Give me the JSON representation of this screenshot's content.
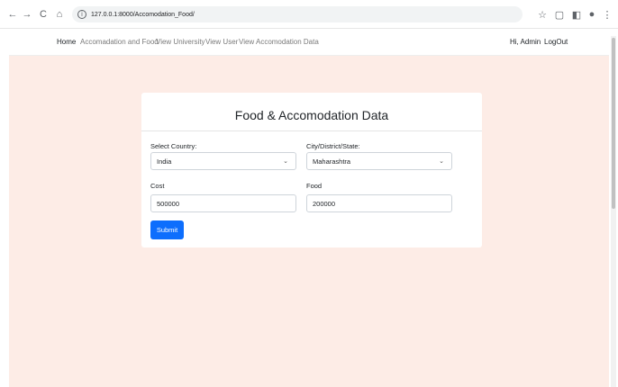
{
  "browser": {
    "url": "127.0.0.1:8000/Accomodation_Food/",
    "back_icon": "←",
    "forward_icon": "→",
    "reload_icon": "C",
    "home_icon": "⌂",
    "info_icon": "i",
    "star_icon": "☆",
    "extension_icon": "▢",
    "sidebar_icon": "◧",
    "profile_icon": "●",
    "menu_icon": "⋮"
  },
  "nav": {
    "home": "Home",
    "accommodation_food": "Accomadation and Food",
    "view_university": "View University",
    "view_user": "View User",
    "view_accommodation": "View Accomodation Data",
    "greeting": "Hi, Admin",
    "logout": "LogOut"
  },
  "form": {
    "title": "Food & Accomodation Data",
    "country_label": "Select Country:",
    "country_value": "India",
    "city_label": "City/District/State:",
    "city_value": "Maharashtra",
    "cost_label": "Cost",
    "cost_value": "500000",
    "food_label": "Food",
    "food_value": "200000",
    "submit_label": "Submit"
  },
  "colors": {
    "page_background": "#fdece6",
    "primary_button": "#0d6efd"
  }
}
